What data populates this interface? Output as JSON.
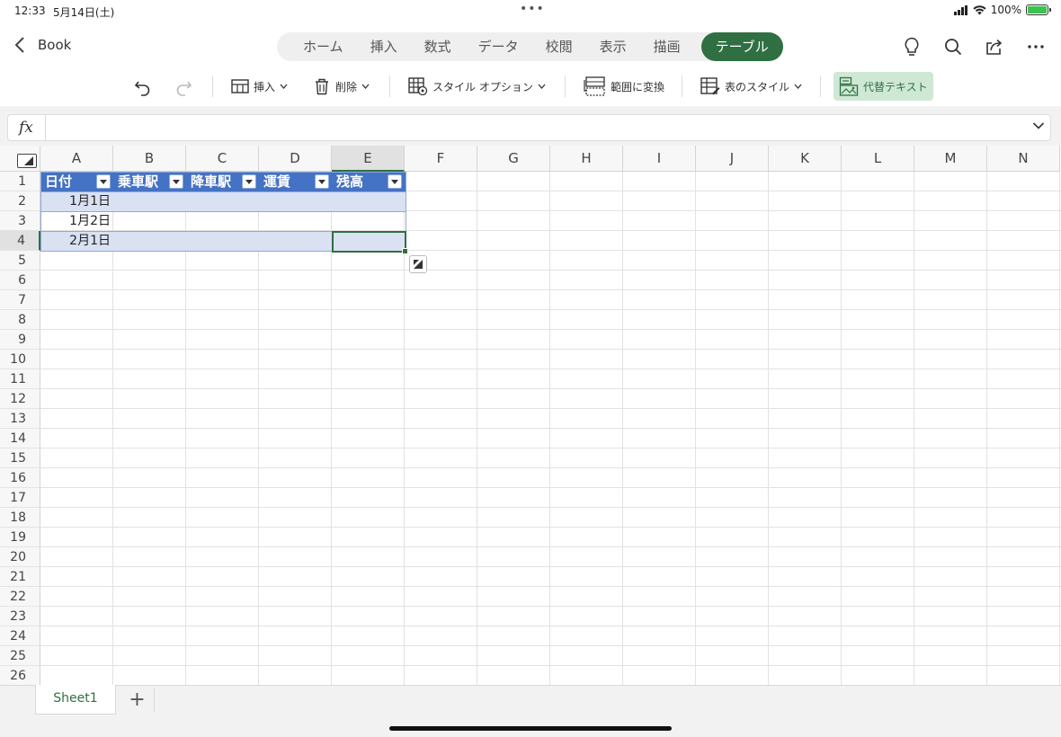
{
  "status": {
    "time": "12:33",
    "date": "5月14日(土)",
    "dots": "•••",
    "battery": "100%"
  },
  "header": {
    "back_label": "Book",
    "tabs": [
      "ホーム",
      "挿入",
      "数式",
      "データ",
      "校閲",
      "表示",
      "描画",
      "テーブル"
    ],
    "active_tab": "テーブル"
  },
  "ribbon": {
    "insert": "挿入",
    "delete": "削除",
    "style_options": "スタイル オプション",
    "convert_range": "範囲に変換",
    "table_styles": "表のスタイル",
    "alt_text": "代替テキスト"
  },
  "formula": {
    "fx": "fx",
    "value": ""
  },
  "columns": [
    "A",
    "B",
    "C",
    "D",
    "E",
    "F",
    "G",
    "H",
    "I",
    "J",
    "K",
    "L",
    "M",
    "N"
  ],
  "rows": [
    "1",
    "2",
    "3",
    "4",
    "5",
    "6",
    "7",
    "8",
    "9",
    "10",
    "11",
    "12",
    "13",
    "14",
    "15",
    "16",
    "17",
    "18",
    "19",
    "20",
    "21",
    "22",
    "23",
    "24",
    "25",
    "26"
  ],
  "selected_cell": "E4",
  "table": {
    "headers": [
      "日付",
      "乗車駅",
      "降車駅",
      "運賃",
      "残高"
    ],
    "dates": [
      "1月1日",
      "1月2日",
      "2月1日"
    ]
  },
  "sheets": {
    "active": "Sheet1",
    "add": "+"
  },
  "colors": {
    "accent": "#2f6f42",
    "table_header": "#4472c4",
    "band": "#d9e1f2"
  }
}
